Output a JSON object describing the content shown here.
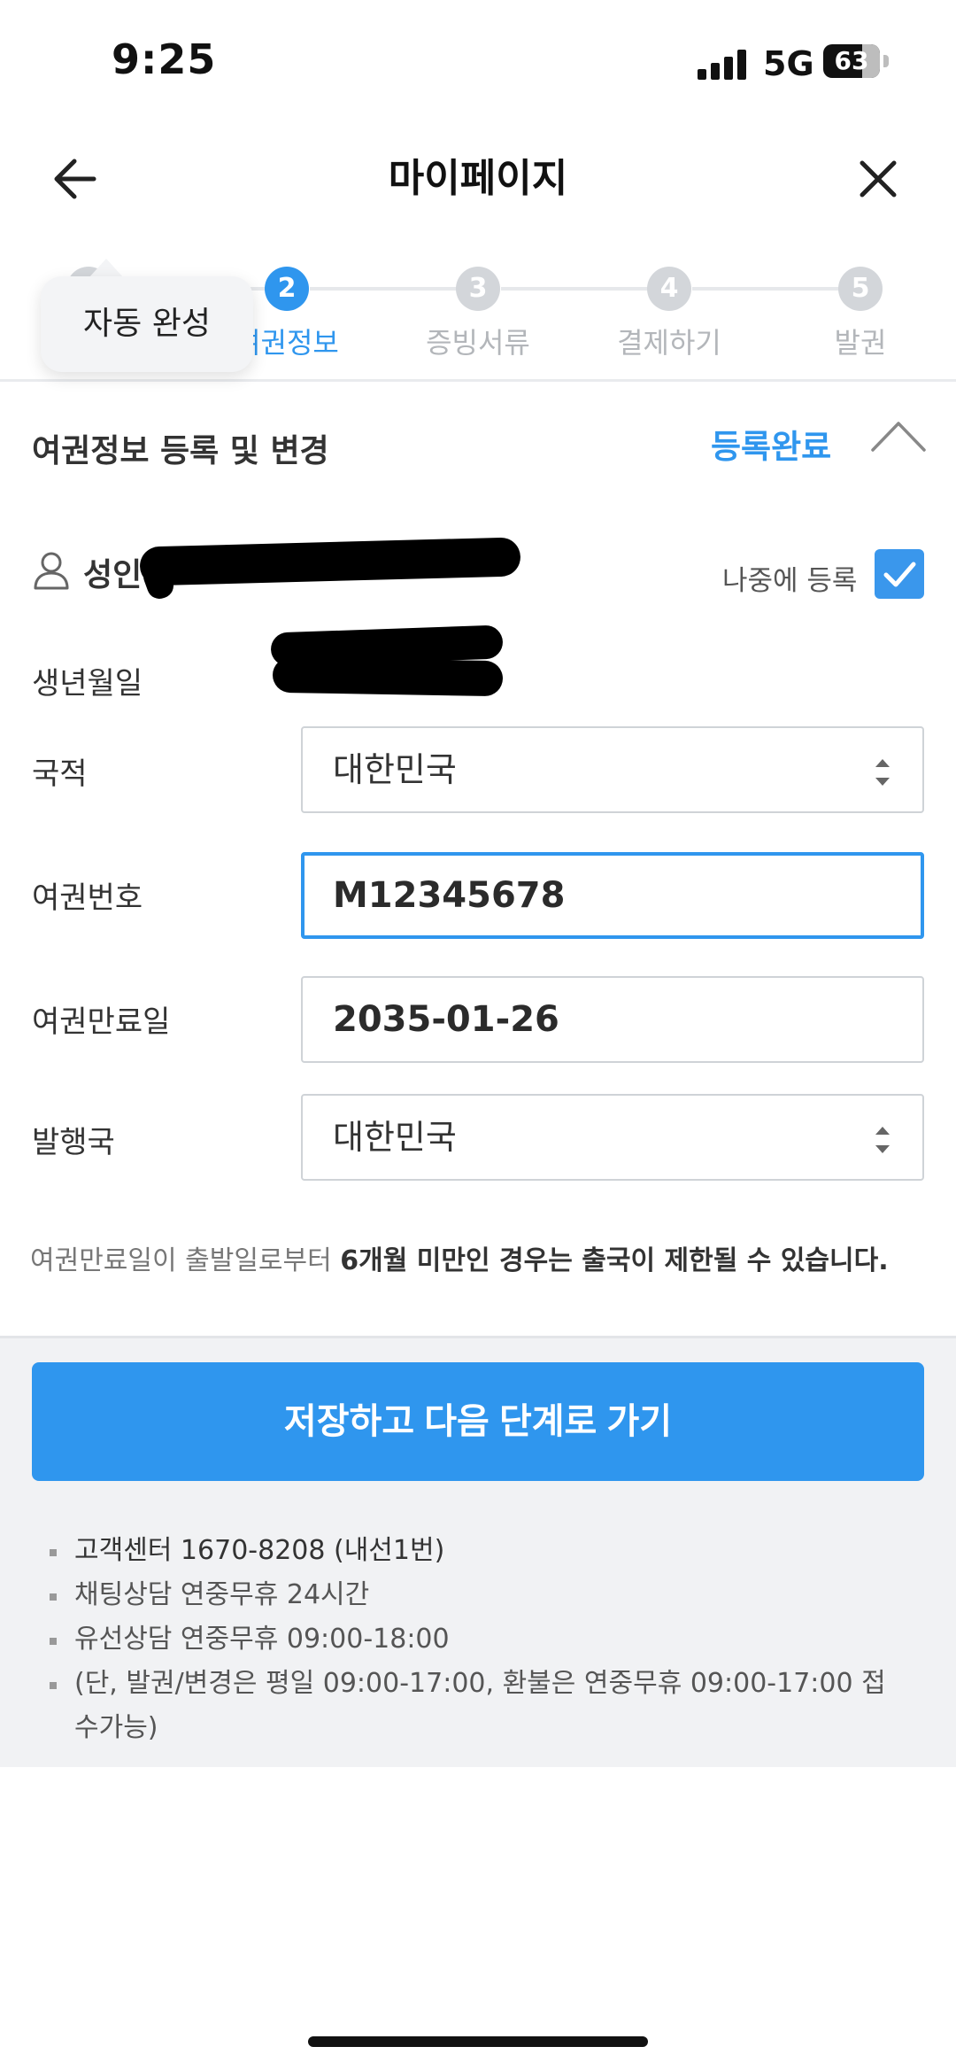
{
  "status_bar": {
    "time": "9:25",
    "network": "5G",
    "battery": "63"
  },
  "header": {
    "title": "마이페이지",
    "back_icon": "arrow-left-icon",
    "close_icon": "close-icon"
  },
  "tooltip": {
    "text": "자동 완성"
  },
  "stepper": {
    "steps": [
      {
        "number": "1",
        "label": ""
      },
      {
        "number": "2",
        "label": "여권정보"
      },
      {
        "number": "3",
        "label": "증빙서류"
      },
      {
        "number": "4",
        "label": "결제하기"
      },
      {
        "number": "5",
        "label": "발권"
      }
    ],
    "active_color": "#2f96ee"
  },
  "section": {
    "title": "여권정보 등록 및 변경",
    "status": "등록완료",
    "collapse_icon": "chevron-up-icon"
  },
  "passenger": {
    "icon": "person-icon",
    "type": "성인",
    "register_later_label": "나중에 등록",
    "register_later_checked": true
  },
  "form": {
    "birth_label": "생년월일",
    "nationality_label": "국적",
    "nationality_value": "대한민국",
    "passport_no_label": "여권번호",
    "passport_no_value": "M12345678",
    "expiry_label": "여권만료일",
    "expiry_value": "2035-01-26",
    "issuing_country_label": "발행국",
    "issuing_country_value": "대한민국"
  },
  "notice": {
    "normal": "여권만료일이 출발일로부터 ",
    "bold": "6개월 미만인 경우는 출국이 제한될 수 있습니다."
  },
  "cta": {
    "label": "저장하고 다음 단계로 가기"
  },
  "info": {
    "items": [
      "고객센터 1670-8208 (내선1번)",
      "채팅상담 연중무휴 24시간",
      "유선상담 연중무휴 09:00-18:00",
      "(단, 발권/변경은 평일 09:00-17:00, 환불은 연중무휴 09:00-17:00 접수가능)"
    ]
  },
  "colors": {
    "accent": "#2f96ee",
    "footer_bg": "#f1f2f4"
  }
}
